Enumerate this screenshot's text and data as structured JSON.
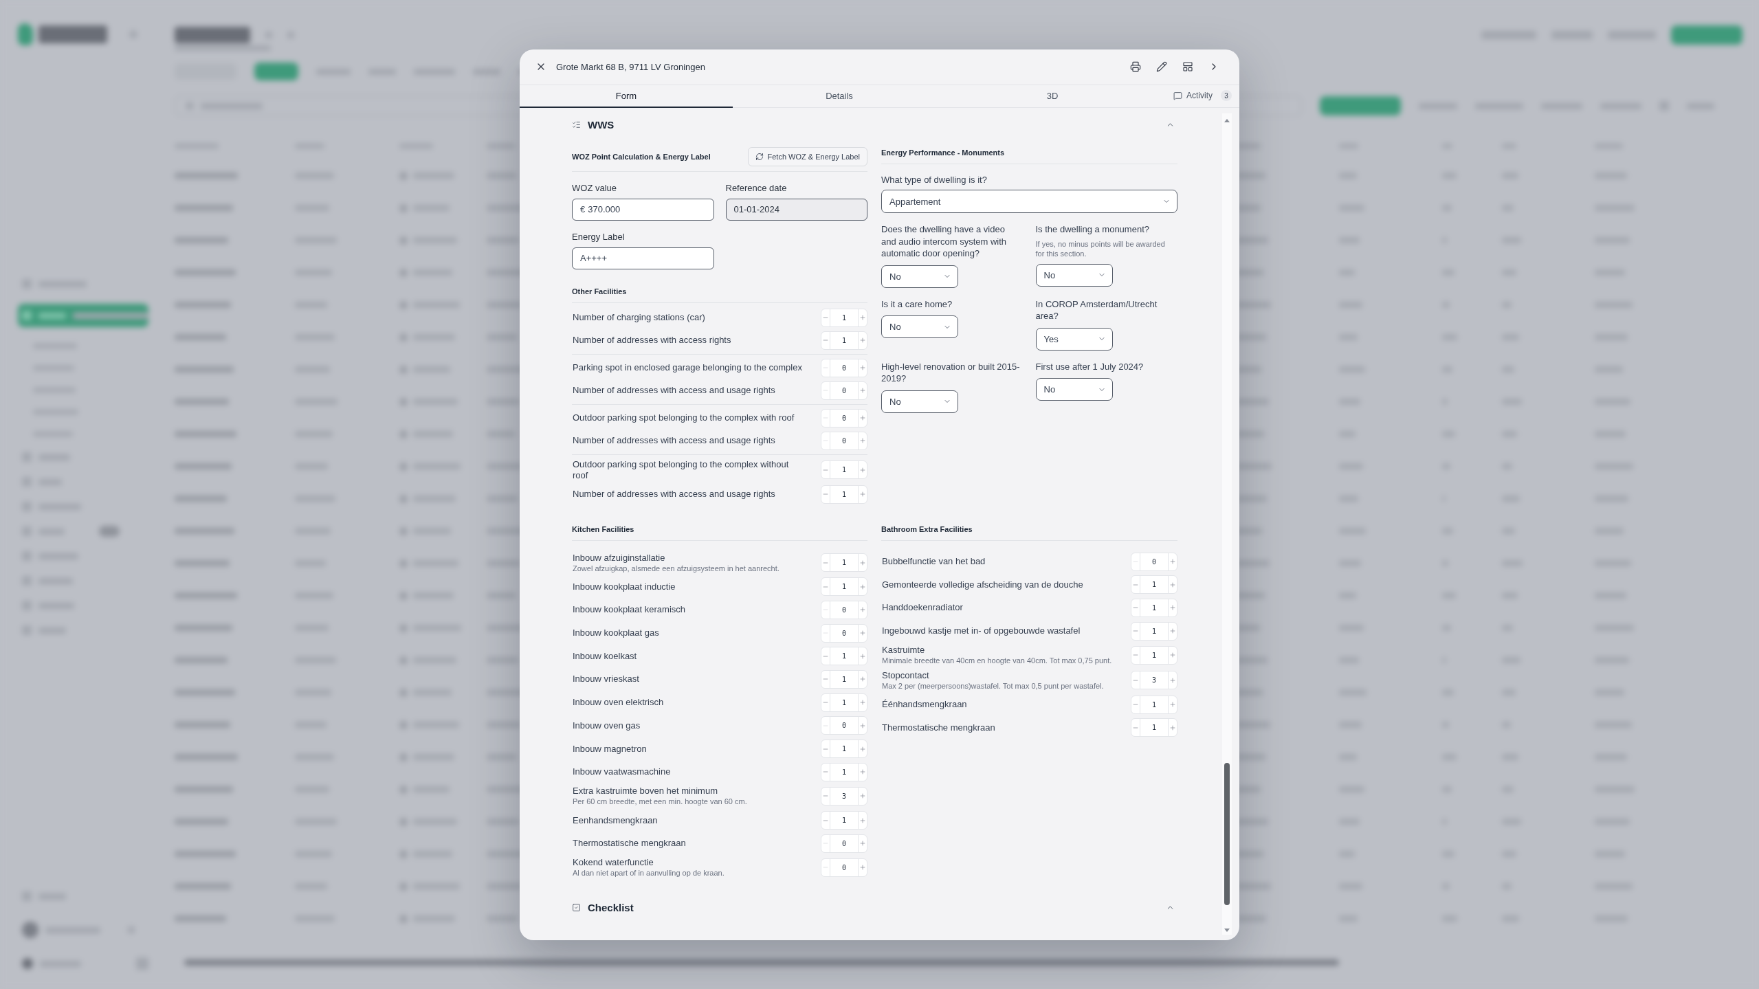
{
  "dialog": {
    "title": "Grote Markt 68 B, 9711 LV Groningen"
  },
  "tabs": [
    {
      "label": "Form",
      "kind": "plain",
      "selected": true
    },
    {
      "label": "Details",
      "kind": "plain",
      "selected": false
    },
    {
      "label": "3D",
      "kind": "plain",
      "selected": false
    },
    {
      "label": "Activity",
      "kind": "activity",
      "count": "3",
      "selected": false
    }
  ],
  "wws": {
    "title": "WWS",
    "expanded": true,
    "woz": {
      "title": "WOZ Point Calculation & Energy Label",
      "button": "Fetch WOZ & Energy Label",
      "fields": [
        {
          "label": "WOZ value",
          "prefix": "€",
          "value": "370.000",
          "disabled": false
        },
        {
          "label": "Reference date",
          "value": "01-01-2024",
          "disabled": true
        },
        {
          "label": "Energy Label",
          "value": "A++++",
          "disabled": false
        }
      ]
    },
    "other_facilities": {
      "title": "Other Facilities",
      "groups": [
        {
          "rows": [
            {
              "label": "Number of charging stations (car)",
              "value": "1",
              "decrement_disabled": false
            },
            {
              "label": "Number of addresses with access rights",
              "value": "1",
              "decrement_disabled": false
            }
          ]
        },
        {
          "rows": [
            {
              "label": "Parking spot in enclosed garage belonging to the complex",
              "value": "0",
              "decrement_disabled": true
            },
            {
              "label": "Number of addresses with access and usage rights",
              "value": "0",
              "decrement_disabled": true
            }
          ]
        },
        {
          "rows": [
            {
              "label": "Outdoor parking spot belonging to the complex with roof",
              "value": "0",
              "decrement_disabled": true
            },
            {
              "label": "Number of addresses with access and usage rights",
              "value": "0",
              "decrement_disabled": true
            }
          ]
        },
        {
          "rows": [
            {
              "label": "Outdoor parking spot belonging to the complex without roof",
              "value": "1",
              "decrement_disabled": false
            },
            {
              "label": "Number of addresses with access and usage rights",
              "value": "1",
              "decrement_disabled": false
            }
          ]
        }
      ]
    },
    "energy_performance": {
      "title": "Energy Performance - Monuments",
      "dwelling_type": {
        "label": "What type of dwelling is it?",
        "value": "Appartement"
      },
      "questions": [
        {
          "label": "Does the dwelling have a video and audio intercom system with automatic door opening?",
          "value": "No"
        },
        {
          "label": "Is the dwelling a monument?",
          "hint": "If yes, no minus points will be awarded for this section.",
          "value": "No"
        },
        {
          "label": "Is it a care home?",
          "value": "No"
        },
        {
          "label": "In COROP Amsterdam/Utrecht area?",
          "value": "Yes"
        },
        {
          "label": "High-level renovation or built 2015-2019?",
          "value": "No"
        },
        {
          "label": "First use after 1 July 2024?",
          "value": "No"
        }
      ]
    },
    "kitchen_facilities": {
      "title": "Kitchen Facilities",
      "rows": [
        {
          "label": "Inbouw afzuiginstallatie",
          "hint": "Zowel afzuigkap, alsmede een afzuigsysteem in het aanrecht.",
          "value": "1",
          "decrement_disabled": false
        },
        {
          "label": "Inbouw kookplaat inductie",
          "value": "1",
          "decrement_disabled": false
        },
        {
          "label": "Inbouw kookplaat keramisch",
          "value": "0",
          "decrement_disabled": true
        },
        {
          "label": "Inbouw kookplaat gas",
          "value": "0",
          "decrement_disabled": true
        },
        {
          "label": "Inbouw koelkast",
          "value": "1",
          "decrement_disabled": false
        },
        {
          "label": "Inbouw vrieskast",
          "value": "1",
          "decrement_disabled": false
        },
        {
          "label": "Inbouw oven elektrisch",
          "value": "1",
          "decrement_disabled": false
        },
        {
          "label": "Inbouw oven gas",
          "value": "0",
          "decrement_disabled": true
        },
        {
          "label": "Inbouw magnetron",
          "value": "1",
          "decrement_disabled": false
        },
        {
          "label": "Inbouw vaatwasmachine",
          "value": "1",
          "decrement_disabled": false
        },
        {
          "label": "Extra kastruimte boven het minimum",
          "hint": "Per 60 cm breedte, met een min. hoogte van 60 cm.",
          "value": "3",
          "decrement_disabled": false
        },
        {
          "label": "Eenhandsmengkraan",
          "value": "1",
          "decrement_disabled": false
        },
        {
          "label": "Thermostatische mengkraan",
          "value": "0",
          "decrement_disabled": true
        },
        {
          "label": "Kokend waterfunctie",
          "hint": "Al dan niet apart of in aanvulling op de kraan.",
          "value": "0",
          "decrement_disabled": true
        }
      ]
    },
    "bathroom_extra_facilities": {
      "title": "Bathroom Extra Facilities",
      "rows": [
        {
          "label": "Bubbelfunctie van het bad",
          "value": "0",
          "decrement_disabled": true
        },
        {
          "label": "Gemonteerde volledige afscheiding van de douche",
          "value": "1",
          "decrement_disabled": false
        },
        {
          "label": "Handdoekenradiator",
          "value": "1",
          "decrement_disabled": false
        },
        {
          "label": "Ingebouwd kastje met in- of opgebouwde wastafel",
          "value": "1",
          "decrement_disabled": false
        },
        {
          "label": "Kastruimte",
          "hint": "Minimale breedte van 40cm en hoogte van 40cm. Tot max 0,75 punt.",
          "value": "1",
          "decrement_disabled": false
        },
        {
          "label": "Stopcontact",
          "hint": "Max 2 per (meerpersoons)wastafel. Tot max 0,5 punt per wastafel.",
          "value": "3",
          "decrement_disabled": false
        },
        {
          "label": "Éénhandsmengkraan",
          "value": "1",
          "decrement_disabled": false
        },
        {
          "label": "Thermostatische mengkraan",
          "value": "1",
          "decrement_disabled": false
        }
      ]
    }
  },
  "checklist": {
    "title": "Checklist",
    "expanded": true
  }
}
